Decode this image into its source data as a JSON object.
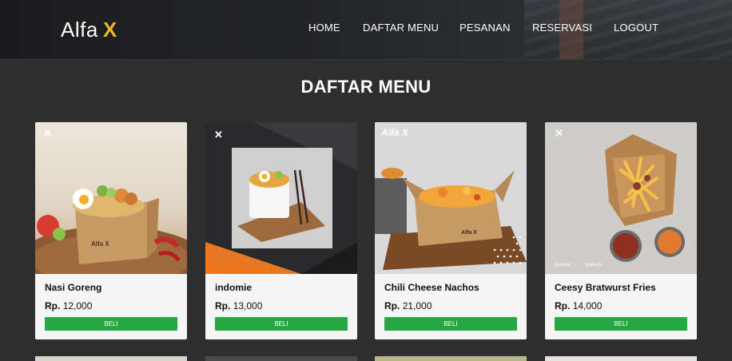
{
  "brand": {
    "name": "Alfa",
    "mark": "X"
  },
  "nav": {
    "items": [
      "HOME",
      "DAFTAR MENU",
      "PESANAN",
      "RESERVASI",
      "LOGOUT"
    ]
  },
  "page": {
    "title": "DAFTAR MENU"
  },
  "menu": [
    {
      "name": "Nasi Goreng",
      "currency": "Rp.",
      "price": "12,000",
      "button": "BELI"
    },
    {
      "name": "indomie",
      "currency": "Rp.",
      "price": "13,000",
      "button": "BELI"
    },
    {
      "name": "Chili Cheese Nachos",
      "currency": "Rp.",
      "price": "21,000",
      "button": "BELI"
    },
    {
      "name": "Ceesy Bratwurst Fries",
      "currency": "Rp.",
      "price": "14,000",
      "button": "BELI"
    }
  ],
  "watermark": {
    "logo_text": "Alfa X",
    "box_text": "Alfa X"
  },
  "colors": {
    "accent": "#f0b429",
    "buy_button": "#28a745",
    "background": "#2f2e2e",
    "card": "#f5f5f5"
  }
}
